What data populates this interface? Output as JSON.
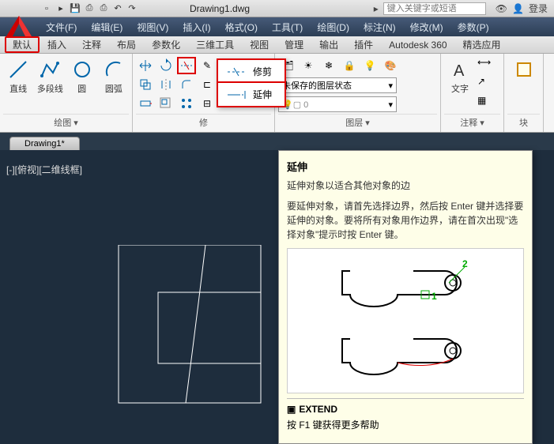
{
  "title": "Drawing1.dwg",
  "search_placeholder": "键入关键字或短语",
  "login": "登录",
  "menus": [
    "文件(F)",
    "编辑(E)",
    "视图(V)",
    "插入(I)",
    "格式(O)",
    "工具(T)",
    "绘图(D)",
    "标注(N)",
    "修改(M)",
    "参数(P)"
  ],
  "tabs": [
    "默认",
    "插入",
    "注释",
    "布局",
    "参数化",
    "三维工具",
    "视图",
    "管理",
    "输出",
    "插件",
    "Autodesk 360",
    "精选应用"
  ],
  "panel_draw": {
    "title": "绘图 ▾",
    "line": "直线",
    "pline": "多段线",
    "circle": "圆",
    "arc": "圆弧"
  },
  "panel_modify_title": "修",
  "panel_layer": {
    "title": "图层 ▾",
    "state": "未保存的图层状态"
  },
  "panel_anno": {
    "title": "注释 ▾",
    "text": "文字"
  },
  "panel_block": "块",
  "flyout": {
    "trim": "修剪",
    "extend": "延伸"
  },
  "doc_tab": "Drawing1*",
  "view_label": "[-][俯视][二维线框]",
  "tooltip": {
    "title": "延伸",
    "summary": "延伸对象以适合其他对象的边",
    "detail": "要延伸对象，请首先选择边界，然后按 Enter 键并选择要延伸的对象。要将所有对象用作边界，请在首次出现\"选择对象\"提示时按 Enter 键。",
    "cmd": "EXTEND",
    "help": "按 F1 键获得更多帮助"
  }
}
